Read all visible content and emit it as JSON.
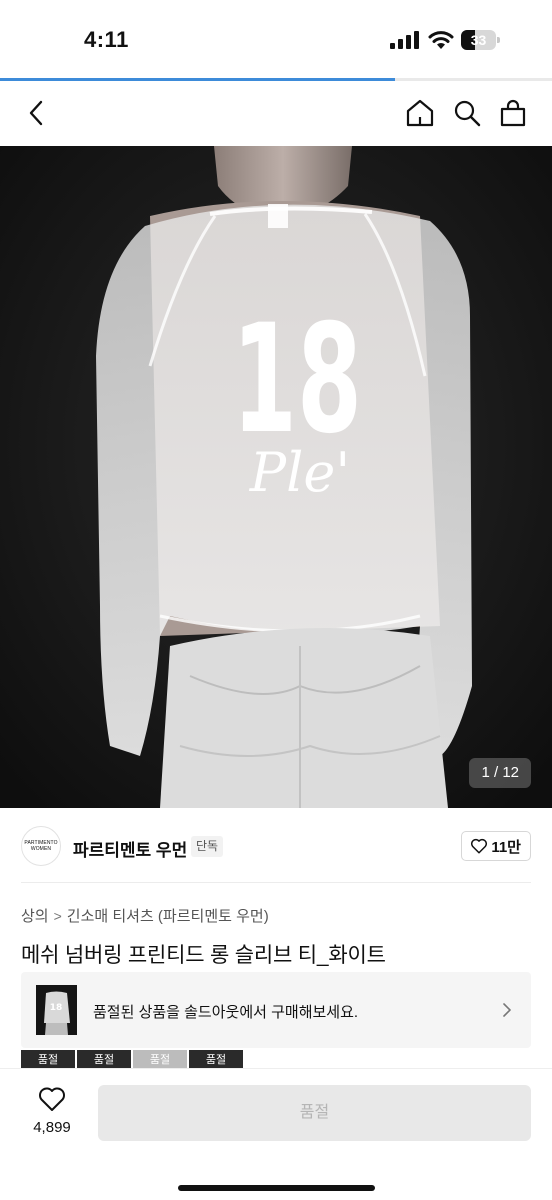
{
  "status_bar": {
    "time": "4:11",
    "battery": "33"
  },
  "page_progress_fraction": 0.715,
  "nav": {
    "icons": [
      "back-icon",
      "home-icon",
      "search-icon",
      "bag-icon"
    ]
  },
  "gallery": {
    "counter": "1 / 12",
    "shirt_number": "18",
    "shirt_script": "Ple'"
  },
  "brand": {
    "logo_line1": "PARTIMENTO",
    "logo_line2": "WOMEN",
    "name": "파르티멘토 우먼",
    "tag": "단독",
    "likes": "11만"
  },
  "breadcrumb": {
    "level1": "상의",
    "level2": "긴소매 티셔츠 (파르티멘토 우먼)"
  },
  "product": {
    "title": "메쉬 넘버링 프린티드 롱 슬리브 티_화이트"
  },
  "banner": {
    "text": "품절된 상품을 솔드아웃에서 구매해보세요."
  },
  "thumbs": [
    "품절",
    "품절",
    "품절",
    "품절"
  ],
  "bottom_bar": {
    "wish_count": "4,899",
    "buy_label": "품절"
  }
}
